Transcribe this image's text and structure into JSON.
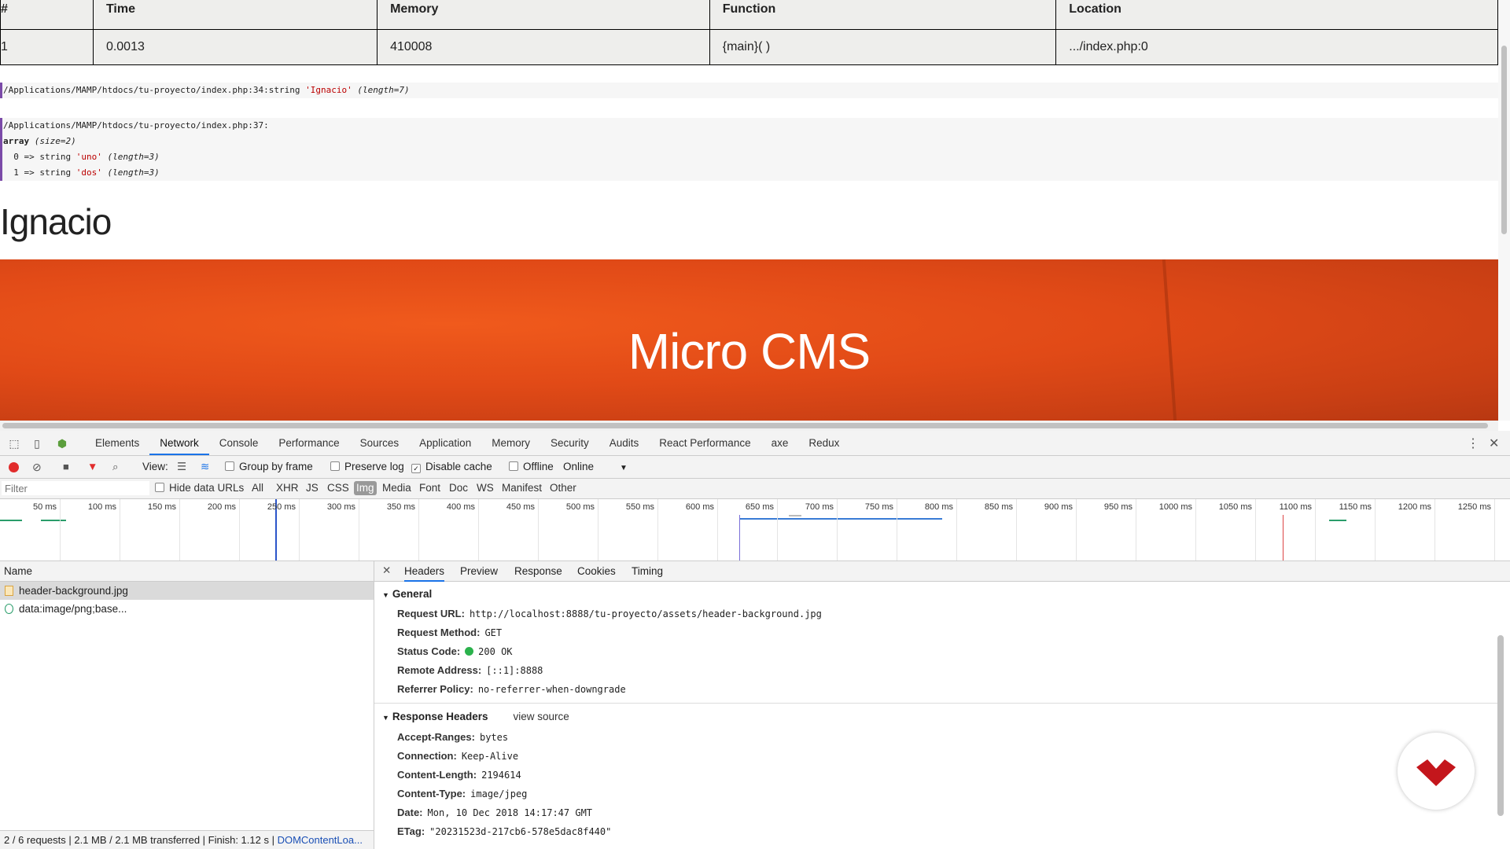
{
  "trace_table": {
    "headers": [
      "#",
      "Time",
      "Memory",
      "Function",
      "Location"
    ],
    "rows": [
      [
        "1",
        "0.0013",
        "410008",
        "{main}( )",
        ".../index.php:0"
      ]
    ]
  },
  "dump1": {
    "path": "/Applications/MAMP/htdocs/tu-proyecto/index.php:34:",
    "type": "string",
    "value": "'Ignacio'",
    "length": "(length=7)"
  },
  "dump2": {
    "path": "/Applications/MAMP/htdocs/tu-proyecto/index.php:37:",
    "array": "array",
    "size": "(size=2)",
    "items": [
      {
        "key": "0",
        "arrow": "=>",
        "type": "string",
        "value": "'uno'",
        "length": "(length=3)"
      },
      {
        "key": "1",
        "arrow": "=>",
        "type": "string",
        "value": "'dos'",
        "length": "(length=3)"
      }
    ]
  },
  "big_name": "Ignacio",
  "hero_title": "Micro CMS",
  "devtools": {
    "tabs": [
      "Elements",
      "Network",
      "Console",
      "Performance",
      "Sources",
      "Application",
      "Memory",
      "Security",
      "Audits",
      "React Performance",
      "axe",
      "Redux"
    ],
    "active_tab": "Network",
    "toolbar": {
      "view_label": "View:",
      "group_by_frame": "Group by frame",
      "preserve_log": "Preserve log",
      "disable_cache": "Disable cache",
      "offline": "Offline",
      "throttle": "Online"
    },
    "filter": {
      "placeholder": "Filter",
      "hide_data_urls": "Hide data URLs",
      "types": [
        "All",
        "XHR",
        "JS",
        "CSS",
        "Img",
        "Media",
        "Font",
        "Doc",
        "WS",
        "Manifest",
        "Other"
      ],
      "active_type": "Img"
    },
    "timeline_ticks": [
      "50 ms",
      "100 ms",
      "150 ms",
      "200 ms",
      "250 ms",
      "300 ms",
      "350 ms",
      "400 ms",
      "450 ms",
      "500 ms",
      "550 ms",
      "600 ms",
      "650 ms",
      "700 ms",
      "750 ms",
      "800 ms",
      "850 ms",
      "900 ms",
      "950 ms",
      "1000 ms",
      "1050 ms",
      "1100 ms",
      "1150 ms",
      "1200 ms",
      "1250 ms"
    ],
    "requests_header": "Name",
    "requests": [
      "header-background.jpg",
      "data:image/png;base..."
    ],
    "status_bar": "2 / 6 requests | 2.1 MB / 2.1 MB transferred | Finish: 1.12 s | ",
    "status_link": "DOMContentLoa...",
    "detail_tabs": [
      "Headers",
      "Preview",
      "Response",
      "Cookies",
      "Timing"
    ],
    "active_detail_tab": "Headers",
    "general_title": "General",
    "general": [
      {
        "k": "Request URL:",
        "v": "http://localhost:8888/tu-proyecto/assets/header-background.jpg"
      },
      {
        "k": "Request Method:",
        "v": "GET"
      },
      {
        "k": "Status Code:",
        "v": "200 OK"
      },
      {
        "k": "Remote Address:",
        "v": "[::1]:8888"
      },
      {
        "k": "Referrer Policy:",
        "v": "no-referrer-when-downgrade"
      }
    ],
    "response_headers_title": "Response Headers",
    "view_source": "view source",
    "response_headers": [
      {
        "k": "Accept-Ranges:",
        "v": "bytes"
      },
      {
        "k": "Connection:",
        "v": "Keep-Alive"
      },
      {
        "k": "Content-Length:",
        "v": "2194614"
      },
      {
        "k": "Content-Type:",
        "v": "image/jpeg"
      },
      {
        "k": "Date:",
        "v": "Mon, 10 Dec 2018 14:17:47 GMT"
      },
      {
        "k": "ETag:",
        "v": "\"20231523d-217cb6-578e5dac8f440\""
      }
    ]
  },
  "colors": {
    "accent": "#1a73e8",
    "record": "#e12c2c",
    "hero": "#e14a17",
    "brand": "#c4161c"
  }
}
